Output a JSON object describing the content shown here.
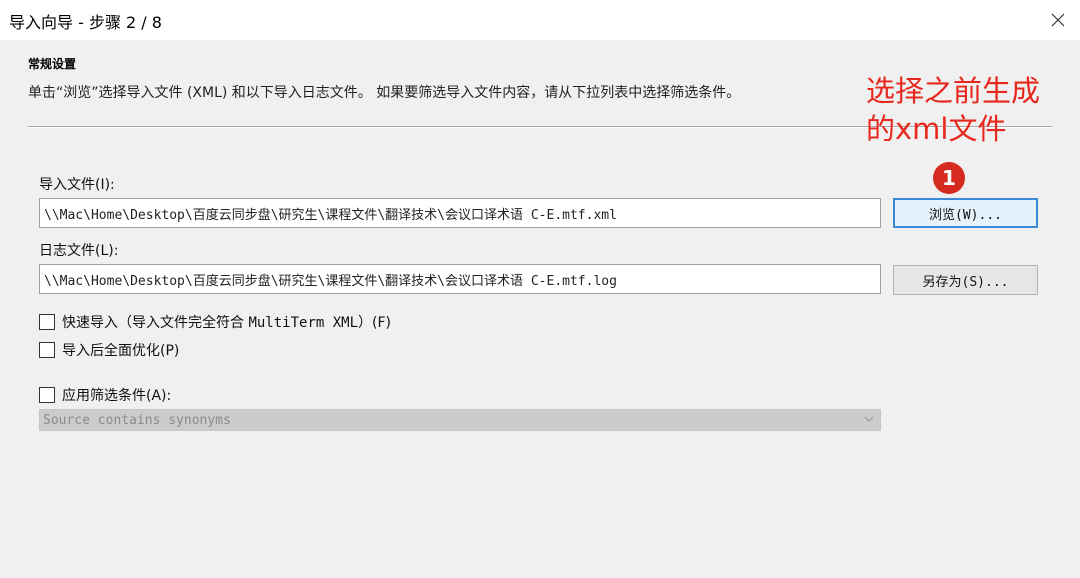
{
  "window": {
    "title": "导入向导 - 步骤 2 / 8",
    "close_icon": "close-icon"
  },
  "general": {
    "heading": "常规设置",
    "description": "单击“浏览”选择导入文件 (XML) 和以下导入日志文件。 如果要筛选导入文件内容，请从下拉列表中选择筛选条件。"
  },
  "import_file": {
    "label": "导入文件(I):",
    "value": "\\\\Mac\\Home\\Desktop\\百度云同步盘\\研究生\\课程文件\\翻译技术\\会议口译术语 C-E.mtf.xml",
    "browse_label": "浏览(W)..."
  },
  "log_file": {
    "label": "日志文件(L):",
    "value": "\\\\Mac\\Home\\Desktop\\百度云同步盘\\研究生\\课程文件\\翻译技术\\会议口译术语 C-E.mtf.log",
    "save_as_label": "另存为(S)..."
  },
  "options": {
    "fast_import_prefix": "快速导入（导入文件完全符合 ",
    "fast_import_mono": "MultiTerm XML",
    "fast_import_suffix": "）(F)",
    "fast_import_checked": false,
    "optimize_label": "导入后全面优化(P)",
    "optimize_checked": false,
    "apply_filter_label": "应用筛选条件(A):",
    "apply_filter_checked": false,
    "filter_value": "Source contains synonyms",
    "filter_enabled": false
  },
  "annotation": {
    "line1": "选择之前生成",
    "line2": "的xml文件",
    "step_number": "1",
    "color": "#e8281e"
  }
}
